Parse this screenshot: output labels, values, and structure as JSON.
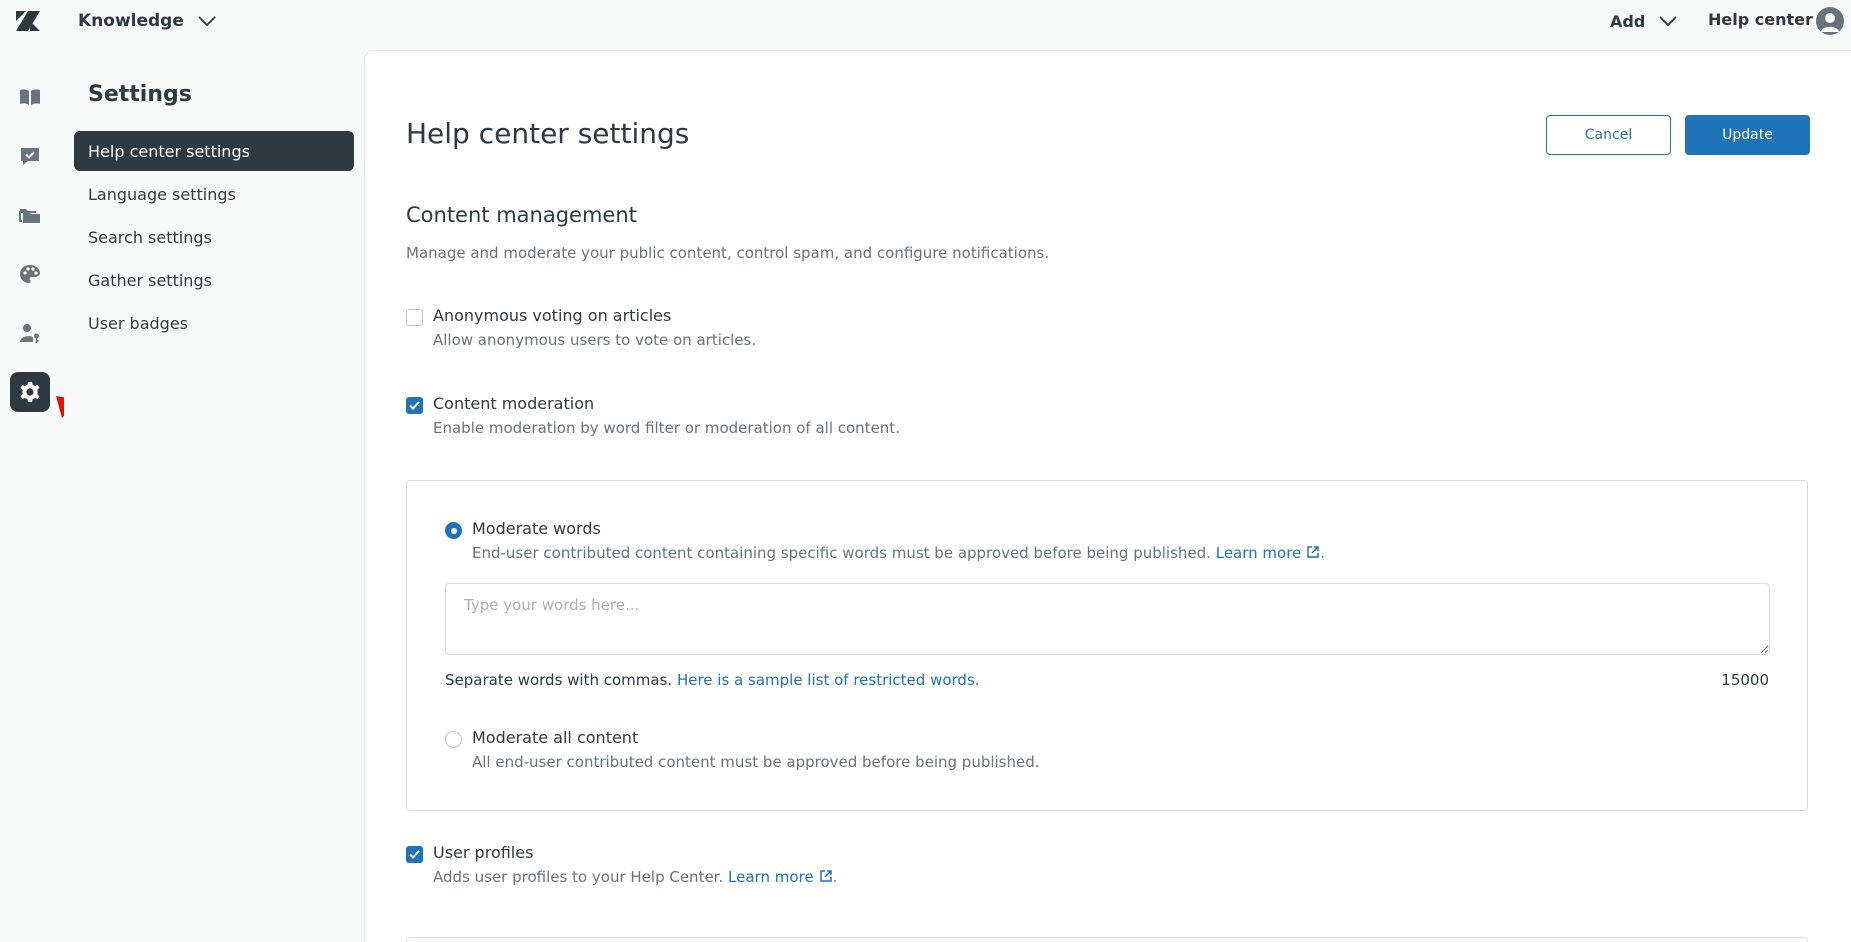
{
  "topbar": {
    "product_name": "Knowledge",
    "add_label": "Add",
    "help_center_label": "Help center"
  },
  "rail": {
    "items": [
      {
        "icon": "book-icon"
      },
      {
        "icon": "task-chat-icon"
      },
      {
        "icon": "folders-icon"
      },
      {
        "icon": "palette-icon"
      },
      {
        "icon": "user-key-icon"
      },
      {
        "icon": "gear-icon",
        "active": true
      }
    ]
  },
  "subnav": {
    "title": "Settings",
    "items": [
      {
        "label": "Help center settings",
        "active": true
      },
      {
        "label": "Language settings"
      },
      {
        "label": "Search settings"
      },
      {
        "label": "Gather settings"
      },
      {
        "label": "User badges"
      }
    ]
  },
  "main": {
    "title": "Help center settings",
    "cancel_label": "Cancel",
    "update_label": "Update",
    "section": {
      "title": "Content management",
      "description": "Manage and moderate your public content, control spam, and configure notifications."
    },
    "anonymous_voting": {
      "label": "Anonymous voting on articles",
      "hint": "Allow anonymous users to vote on articles.",
      "checked": false
    },
    "content_moderation": {
      "label": "Content moderation",
      "hint": "Enable moderation by word filter or moderation of all content.",
      "checked": true
    },
    "moderate_words": {
      "label": "Moderate words",
      "hint": "End-user contributed content containing specific words must be approved before being published.",
      "learn_more": "Learn more",
      "selected": true,
      "input_placeholder": "Type your words here...",
      "input_value": "",
      "help_text": "Separate words with commas.",
      "help_link": "Here is a sample list of restricted words.",
      "char_count": "15000"
    },
    "moderate_all": {
      "label": "Moderate all content",
      "hint": "All end-user contributed content must be approved before being published.",
      "selected": false
    },
    "user_profiles": {
      "label": "User profiles",
      "hint": "Adds user profiles to your Help Center.",
      "learn_more": "Learn more",
      "checked": true
    }
  },
  "colors": {
    "accent": "#1f73b7",
    "dark": "#2f3941",
    "muted": "#68737d",
    "annotation": "#e3120b"
  }
}
